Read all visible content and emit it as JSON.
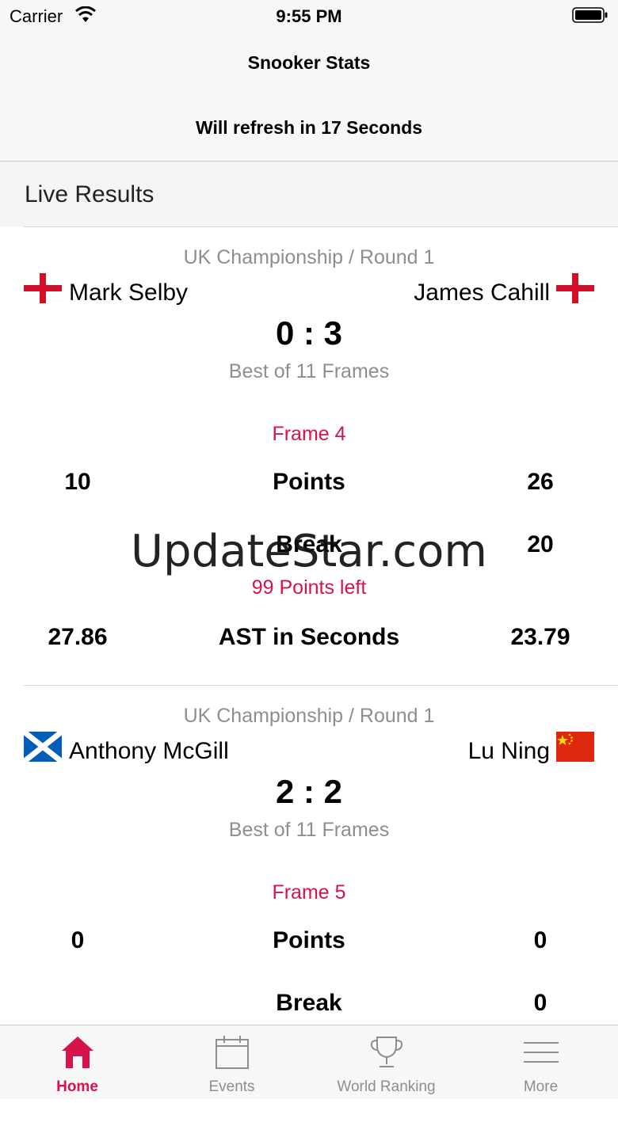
{
  "status": {
    "carrier": "Carrier",
    "time": "9:55 PM"
  },
  "header": {
    "title": "Snooker Stats",
    "refresh": "Will refresh in 17 Seconds"
  },
  "section": {
    "title": "Live Results"
  },
  "matches": [
    {
      "event": "UK Championship / Round 1",
      "player1": {
        "name": "Mark Selby",
        "flag": "england-flag"
      },
      "player2": {
        "name": "James Cahill",
        "flag": "england-flag"
      },
      "score": "0 : 3",
      "best_of": "Best of 11 Frames",
      "frame": "Frame 4",
      "points": {
        "label": "Points",
        "p1": "10",
        "p2": "26"
      },
      "break": {
        "label": "Break",
        "p1": "",
        "p2": "20"
      },
      "points_left": "99 Points left",
      "ast": {
        "label": "AST in Seconds",
        "p1": "27.86",
        "p2": "23.79"
      }
    },
    {
      "event": "UK Championship / Round 1",
      "player1": {
        "name": "Anthony McGill",
        "flag": "scotland-flag"
      },
      "player2": {
        "name": "Lu Ning",
        "flag": "china-flag"
      },
      "score": "2 : 2",
      "best_of": "Best of 11 Frames",
      "frame": "Frame 5",
      "points": {
        "label": "Points",
        "p1": "0",
        "p2": "0"
      },
      "break": {
        "label": "Break",
        "p1": "",
        "p2": "0"
      }
    }
  ],
  "watermark": "UpdateStar.com",
  "tabs": [
    {
      "label": "Home",
      "icon": "home-icon",
      "active": true
    },
    {
      "label": "Events",
      "icon": "calendar-icon",
      "active": false
    },
    {
      "label": "World Ranking",
      "icon": "trophy-icon",
      "active": false
    },
    {
      "label": "More",
      "icon": "menu-icon",
      "active": false
    }
  ],
  "colors": {
    "accent": "#d6134a",
    "secondary_text": "#8e8e8e",
    "bar_background": "#f7f7f7"
  }
}
